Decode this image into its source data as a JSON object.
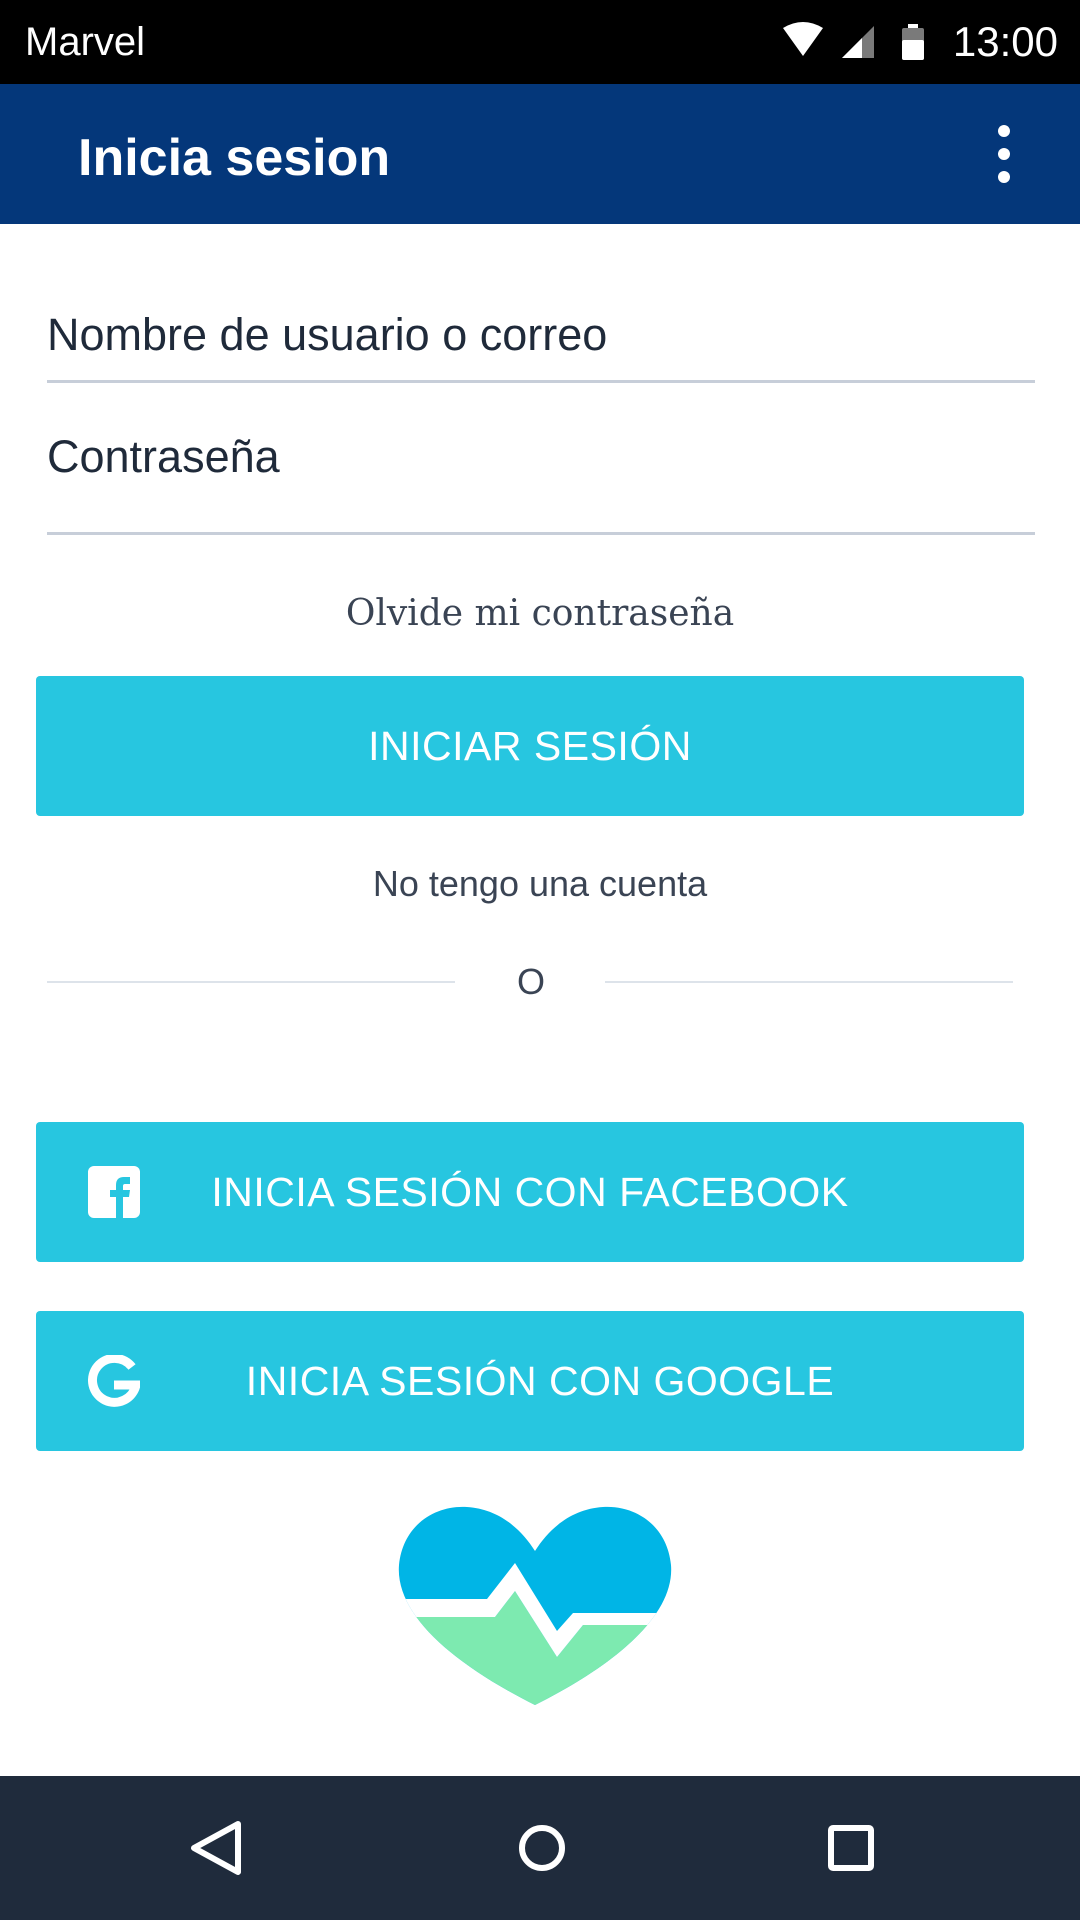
{
  "status_bar": {
    "carrier": "Marvel",
    "time": "13:00"
  },
  "app_bar": {
    "title": "Inicia sesion",
    "menu_icon": "more-vert-icon"
  },
  "form": {
    "username_placeholder": "Nombre de usuario o correo",
    "password_placeholder": "Contraseña",
    "forgot_password": "Olvide mi contraseña",
    "login_button": "INICIAR SESIÓN",
    "no_account": "No tengo una cuenta",
    "divider_text": "O"
  },
  "social": {
    "facebook_label": "INICIA SESIÓN CON FACEBOOK",
    "facebook_icon": "facebook-icon",
    "google_label": "INICIA SESIÓN CON GOOGLE",
    "google_icon": "google-icon"
  },
  "logo_icon": "heart-pulse-icon",
  "nav_bar": {
    "back_icon": "back-icon",
    "home_icon": "home-icon",
    "recents_icon": "recents-icon"
  },
  "colors": {
    "app_bar": "#04377a",
    "button": "#27c6e0",
    "nav_bar": "#1f2b3c",
    "logo_top": "#00b5e6",
    "logo_bottom": "#7deab0"
  }
}
